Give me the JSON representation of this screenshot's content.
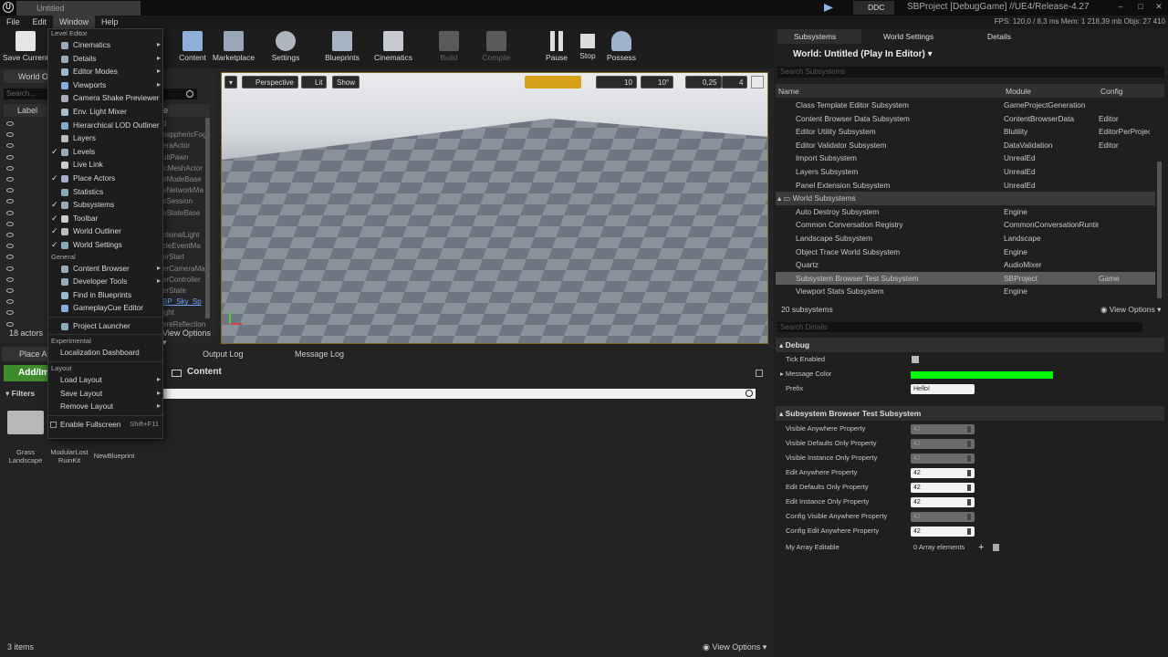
{
  "titlebar": {
    "doc_tab": "Untitled",
    "ddc": "DDC",
    "app_title": "SBProject [DebugGame] //UE4/Release-4.27"
  },
  "menubar": {
    "items": [
      "File",
      "Edit",
      "Window",
      "Help"
    ],
    "stats": "FPS: 120,0   / 8,3 ms   Mem: 1 218,39 mb   Objs: 27 410"
  },
  "toolbar": {
    "save": "Save Current",
    "buttons": [
      "Content",
      "Marketplace",
      "Settings",
      "Blueprints",
      "Cinematics",
      "Build",
      "Compile",
      "Pause",
      "Stop",
      "Possess"
    ]
  },
  "outliner": {
    "tab": "World Ou",
    "search": "Search...",
    "label_col": "Label",
    "type_col": "e",
    "actors_count": "18 actors",
    "view_options": "View Options",
    "types": [
      "d",
      "ospphericFog",
      "eraActor",
      "ultPawn",
      "icMeshActor",
      "eModeBase",
      "eNetworkMa",
      "eSession",
      "eStateBase",
      "",
      "ctionalLight",
      "cleEventMa",
      "erStart",
      "erCameraMa",
      "erController",
      "erState",
      "BP_Sky_Sp",
      "ight",
      "ereReflection"
    ]
  },
  "window_menu": {
    "sections": {
      "level_editor": "Level Editor",
      "general": "General",
      "experimental": "Experimental",
      "layout": "Layout"
    },
    "level_editor_items": [
      "Cinematics",
      "Details",
      "Editor Modes",
      "Viewports",
      "Camera Shake Previewer",
      "Env. Light Mixer",
      "Hierarchical LOD Outliner",
      "Layers",
      "Levels",
      "Live Link",
      "Place Actors",
      "Statistics",
      "Subsystems",
      "Toolbar",
      "World Outliner",
      "World Settings"
    ],
    "general_items": [
      "Content Browser",
      "Developer Tools",
      "Find in Blueprints",
      "GameplayCue Editor"
    ],
    "project_launcher": "Project Launcher",
    "experimental_items": [
      "Localization Dashboard"
    ],
    "layout_items": [
      "Load Layout",
      "Save Layout",
      "Remove Layout"
    ],
    "fullscreen": "Enable Fullscreen",
    "fullscreen_shortcut": "Shift+F11"
  },
  "viewport": {
    "perspective": "Perspective",
    "lit": "Lit",
    "show": "Show",
    "grid": "10",
    "angle": "10°",
    "scale": "0,25",
    "cam_speed": "4"
  },
  "bottom": {
    "place_actors": "Place Ac",
    "add_import": "Add/Im",
    "filters": "Filters",
    "tabs": [
      "Output Log",
      "Message Log"
    ],
    "content_path": "Content",
    "assets": [
      "Grass Landscape",
      "ModularLost RuinKit",
      "NewBlueprint"
    ],
    "items_count": "3 items",
    "view_options": "View Options"
  },
  "right": {
    "tabs": [
      "Subsystems",
      "World Settings",
      "Details"
    ],
    "world": "World: Untitled (Play In Editor)",
    "search_subsystems": "Search Subsystems",
    "cols": [
      "Name",
      "Module",
      "Config"
    ],
    "subsystems": [
      [
        "Class Template Editor Subsystem",
        "GameProjectGeneration",
        ""
      ],
      [
        "Content Browser Data Subsystem",
        "ContentBrowserData",
        "Editor"
      ],
      [
        "Editor Utility Subsystem",
        "Blutility",
        "EditorPerProjectU"
      ],
      [
        "Editor Validator Subsystem",
        "DataValidation",
        "Editor"
      ],
      [
        "Import Subsystem",
        "UnrealEd",
        ""
      ],
      [
        "Layers Subsystem",
        "UnrealEd",
        ""
      ],
      [
        "Panel Extension Subsystem",
        "UnrealEd",
        ""
      ]
    ],
    "world_category": "World Subsystems",
    "world_subsystems": [
      [
        "Auto Destroy Subsystem",
        "Engine",
        ""
      ],
      [
        "Common Conversation Registry",
        "CommonConversationRuntim",
        ""
      ],
      [
        "Landscape Subsystem",
        "Landscape",
        ""
      ],
      [
        "Object Trace World Subsystem",
        "Engine",
        ""
      ],
      [
        "Quartz",
        "AudioMixer",
        ""
      ],
      [
        "Subsystem Browser Test Subsystem",
        "SBProject",
        "Game"
      ],
      [
        "Viewport Stats Subsystem",
        "Engine",
        ""
      ]
    ],
    "count": "20 subsystems",
    "view_options": "View Options",
    "search_details": "Search Details",
    "debug_cat": "Debug",
    "tick_enabled": "Tick Enabled",
    "message_color": "Message Color",
    "prefix": "Prefix",
    "prefix_value": "Hello!",
    "test_cat": "Subsystem Browser Test Subsystem",
    "props": [
      [
        "Visible Anywhere Property",
        "42",
        "ro"
      ],
      [
        "Visible Defaults Only Property",
        "42",
        "ro"
      ],
      [
        "Visible Instance Only Property",
        "42",
        "ro"
      ],
      [
        "Edit Anywhere Property",
        "42",
        "ed"
      ],
      [
        "Edit Defaults Only Property",
        "42",
        "ed"
      ],
      [
        "Edit Instance Only Property",
        "42",
        "ed"
      ],
      [
        "Config Visible Anywhere Property",
        "42",
        "ro"
      ],
      [
        "Config Edit Anywhere Property",
        "42",
        "ed"
      ]
    ],
    "array_label": "My Array Editable",
    "array_value": "0 Array elements"
  },
  "colors": {
    "accent": "#d7a21a",
    "selection": "#5a5a5a",
    "message_color": "#00ff00"
  }
}
